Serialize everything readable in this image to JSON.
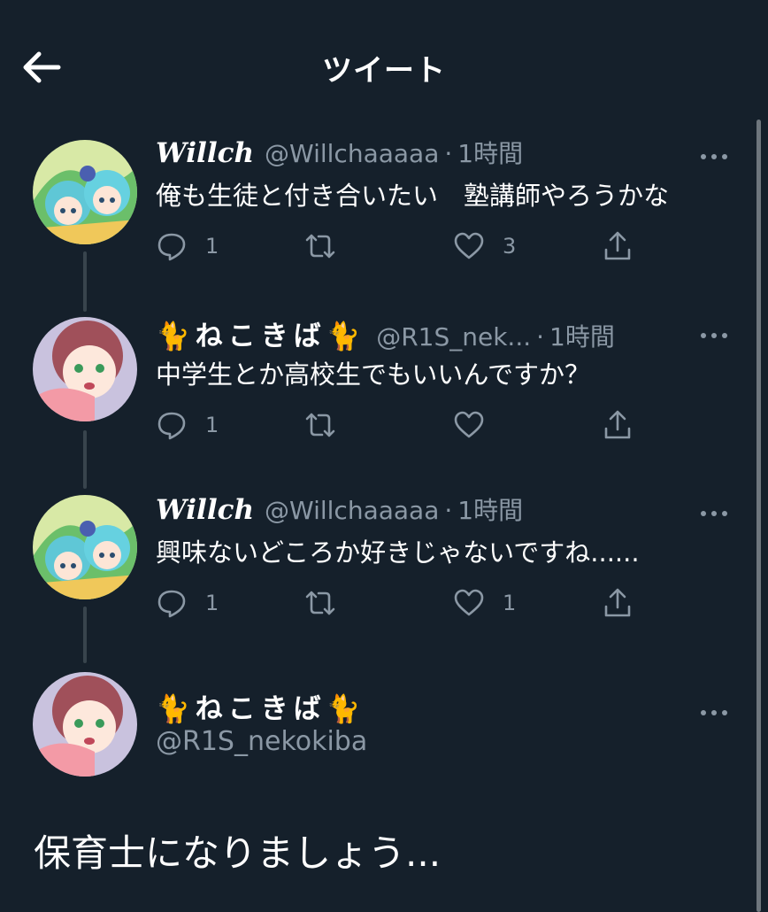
{
  "header": {
    "title": "ツイート"
  },
  "tweets": [
    {
      "name": "Willch",
      "handle": "@Willchaaaaa",
      "time": "1時間",
      "text": "俺も生徒と付き合いたい　塾講師やろうかな",
      "replies": "1",
      "retweets": "",
      "likes": "3"
    },
    {
      "name": "🐈ねこきば🐈",
      "handle": "@R1S_nek...",
      "time": "1時間",
      "text": "中学生とか高校生でもいいんですか？",
      "replies": "1",
      "retweets": "",
      "likes": ""
    },
    {
      "name": "Willch",
      "handle": "@Willchaaaaa",
      "time": "1時間",
      "text": "興味ないどころか好きじゃないですね......",
      "replies": "1",
      "retweets": "",
      "likes": "1"
    }
  ],
  "main": {
    "name": "🐈ねこきば🐈",
    "handle": "@R1S_nekokiba",
    "text": "保育士になりましょう..."
  },
  "sep": "·",
  "colors": {
    "background": "#15202b",
    "muted": "#8b98a5",
    "line": "#38444d"
  },
  "icons": [
    "back-arrow-icon",
    "more-icon",
    "reply-icon",
    "retweet-icon",
    "like-icon",
    "share-icon"
  ]
}
